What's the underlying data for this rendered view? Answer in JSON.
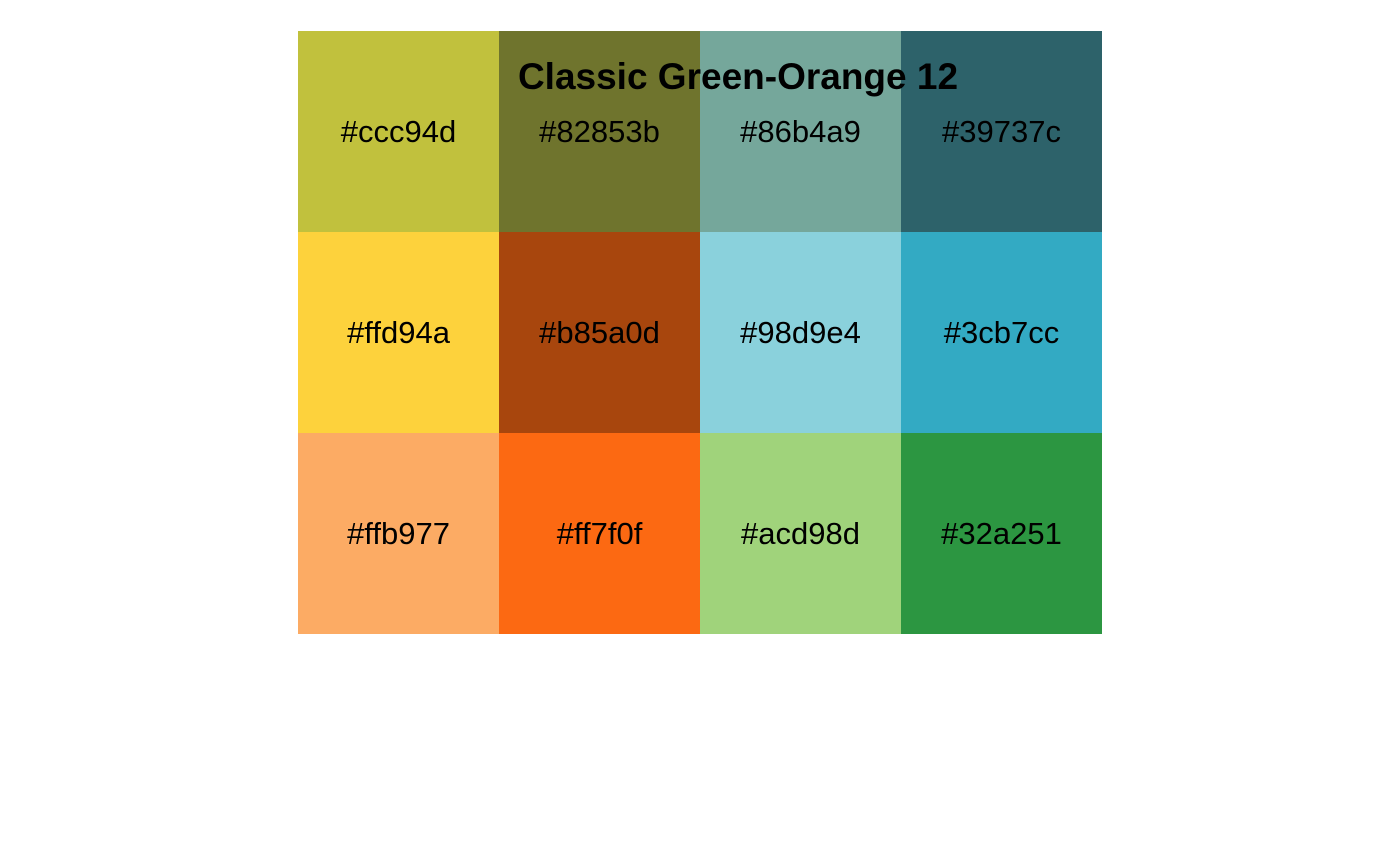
{
  "chart_data": {
    "type": "table",
    "title": "Classic Green-Orange 12",
    "rows": 3,
    "columns": 4,
    "colors": [
      "#ccc94d",
      "#82853b",
      "#86b4a9",
      "#39737c",
      "#ffd94a",
      "#b85a0d",
      "#98d9e4",
      "#3cb7cc",
      "#ffb977",
      "#ff7f0f",
      "#acd98d",
      "#32a251"
    ],
    "rendered_colors": [
      "#c1c13d",
      "#6f742d",
      "#75a79b",
      "#2d626a",
      "#fdd23c",
      "#a8460d",
      "#8ad1dc",
      "#33aac3",
      "#fcab64",
      "#fc6912",
      "#a0d37b",
      "#2c9641"
    ]
  }
}
